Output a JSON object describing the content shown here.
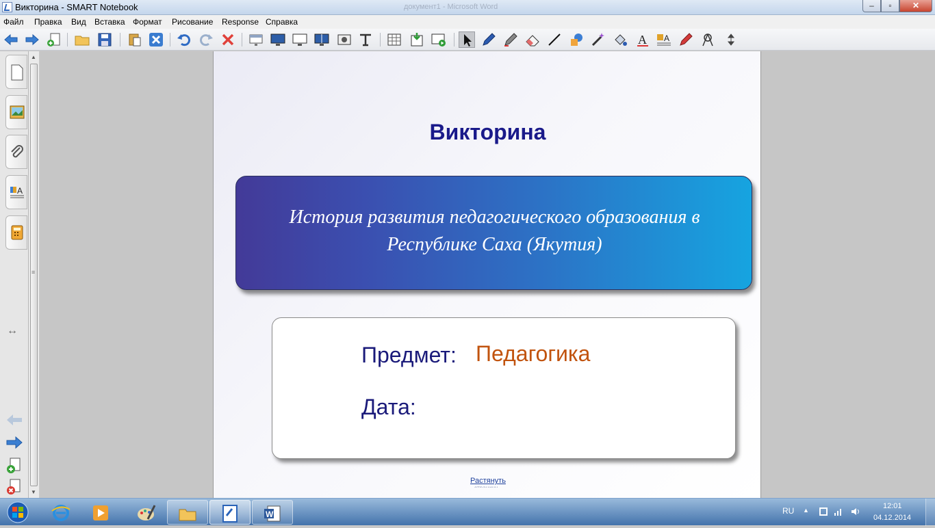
{
  "window": {
    "title": "Викторина - SMART Notebook",
    "background_title": "документ1 - Microsoft Word",
    "minimize": "–",
    "maximize": "▫",
    "close": "✕"
  },
  "menu": [
    "Файл",
    "Правка",
    "Вид",
    "Вставка",
    "Формат",
    "Рисование",
    "Response",
    "Справка"
  ],
  "toolbar_icons": [
    "back-arrow-icon",
    "forward-arrow-icon",
    "add-page-icon",
    "open-folder-icon",
    "save-icon",
    "paste-icon",
    "delete-x-icon",
    "undo-icon",
    "redo-icon",
    "delete-red-x-icon",
    "screen-shade-icon",
    "full-screen-icon",
    "display-icon",
    "dual-display-icon",
    "capture-icon",
    "text-capture-icon",
    "table-icon",
    "insert-icon",
    "response-icon",
    "select-pointer-icon",
    "pen-icon",
    "creative-pen-icon",
    "eraser-icon",
    "line-icon",
    "shape-icon",
    "magic-pen-icon",
    "fill-icon",
    "text-icon",
    "properties-icon",
    "pen-edit-icon",
    "measurement-icon",
    "move-toolbar-icon"
  ],
  "page": {
    "title": "Викторина",
    "banner_text": "История развития педагогического образования в Республике Саха (Якутия)",
    "subject_label": "Предмет:",
    "subject_value": "Педагогика",
    "date_label": "Дата:",
    "date_value": "",
    "stretch_link": "Растянуть",
    "stretch_link2": "страницу"
  },
  "taskbar": {
    "language": "RU",
    "time": "12:01",
    "date": "04.12.2014"
  },
  "colors": {
    "title": "#1a1a8a",
    "banner_start": "#433a98",
    "banner_end": "#16a4e0",
    "subject_value": "#c1530e"
  }
}
